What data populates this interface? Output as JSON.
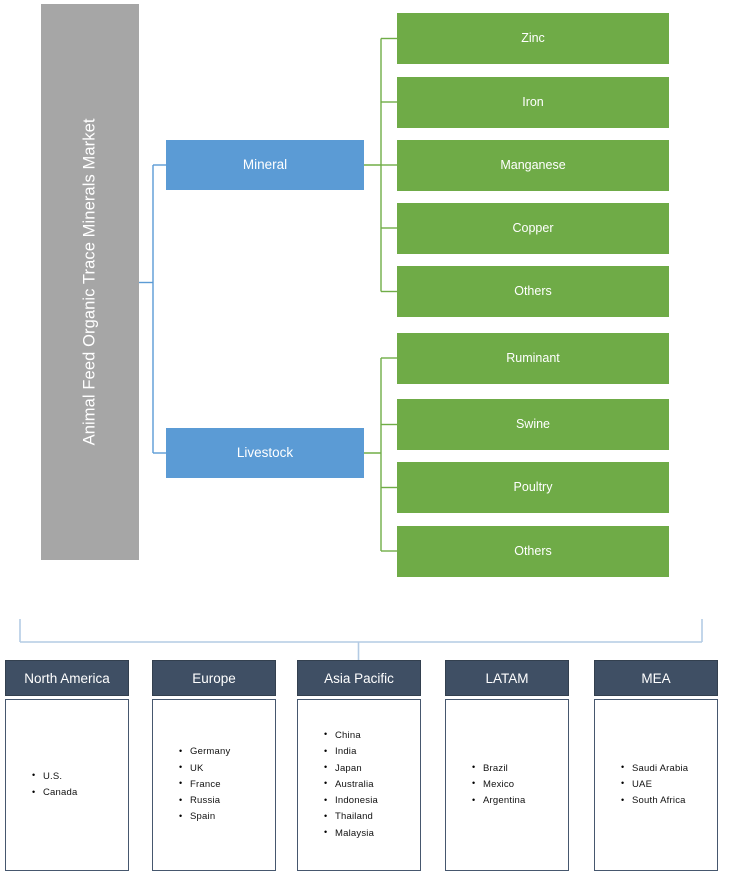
{
  "diagram": {
    "root": {
      "label": "Animal Feed Organic Trace Minerals Market",
      "color": "#a6a6a6"
    },
    "segments": [
      {
        "label": "Mineral",
        "color": "#5b9bd5",
        "children": [
          {
            "label": "Zinc"
          },
          {
            "label": "Iron"
          },
          {
            "label": "Manganese"
          },
          {
            "label": "Copper"
          },
          {
            "label": "Others"
          }
        ]
      },
      {
        "label": "Livestock",
        "color": "#5b9bd5",
        "children": [
          {
            "label": "Ruminant"
          },
          {
            "label": "Swine"
          },
          {
            "label": "Poultry"
          },
          {
            "label": "Others"
          }
        ]
      }
    ],
    "leaf_color": "#6fab47",
    "region_header_color": "#3f4f64",
    "connector_colors": {
      "primary": "#5b9bd5",
      "leaf": "#70ad47",
      "region": "#b4cbe4"
    },
    "regions": [
      {
        "name": "North America",
        "countries": [
          "U.S.",
          "Canada"
        ]
      },
      {
        "name": "Europe",
        "countries": [
          "Germany",
          "UK",
          "France",
          "Russia",
          "Spain"
        ]
      },
      {
        "name": "Asia Pacific",
        "countries": [
          "China",
          "India",
          "Japan",
          "Australia",
          "Indonesia",
          "Thailand",
          "Malaysia"
        ]
      },
      {
        "name": "LATAM",
        "countries": [
          "Brazil",
          "Mexico",
          "Argentina"
        ]
      },
      {
        "name": "MEA",
        "countries": [
          "Saudi Arabia",
          "UAE",
          "South Africa"
        ]
      }
    ]
  }
}
